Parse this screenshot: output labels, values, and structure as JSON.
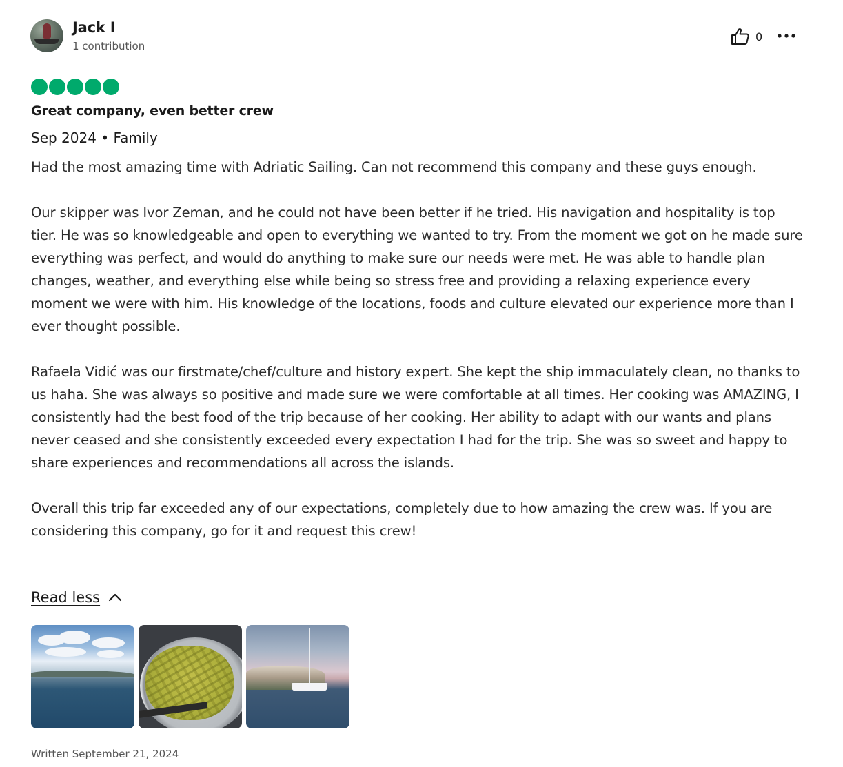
{
  "review": {
    "user": {
      "name": "Jack I",
      "contributions": "1 contribution"
    },
    "like_count": "0",
    "rating": 5,
    "title": "Great company, even better crew",
    "meta": "Sep 2024 • Family",
    "paragraphs": [
      "Had the most amazing time with Adriatic Sailing. Can not recommend this company and these guys enough.",
      "Our skipper was Ivor Zeman, and he could not have been better if he tried. His navigation and hospitality is top tier. He was so knowledgeable and open to everything we wanted to try. From the moment we got on he made sure everything was perfect, and would do anything to make sure our needs were met. He was able to handle plan changes, weather, and everything else while being so stress free and providing a relaxing experience every moment we were with him. His knowledge of the locations, foods and culture elevated our experience more than I ever thought possible.",
      "Rafaela Vidić was our firstmate/chef/culture and history expert. She kept the ship immaculately clean, no thanks to us haha. She was always so positive and made sure we were comfortable at all times. Her cooking was AMAZING, I consistently had the best food of the trip because of her cooking. Her ability to adapt with our wants and plans never ceased and she consistently exceeded every expectation I had for the trip. She was so sweet and happy to share experiences and recommendations all across the islands.",
      "Overall this trip far exceeded any of our expectations, completely due to how amazing the crew was. If you are considering this company, go for it and request this crew!"
    ],
    "read_less_label": "Read less",
    "written_date": "Written September 21, 2024"
  },
  "icons": {
    "like": "thumbs-up-icon",
    "more": "more-options-icon",
    "read_less": "chevron-up-icon"
  },
  "colors": {
    "rating_bubble": "#00aa6c",
    "text": "#1a1a1a",
    "muted": "#555555"
  }
}
